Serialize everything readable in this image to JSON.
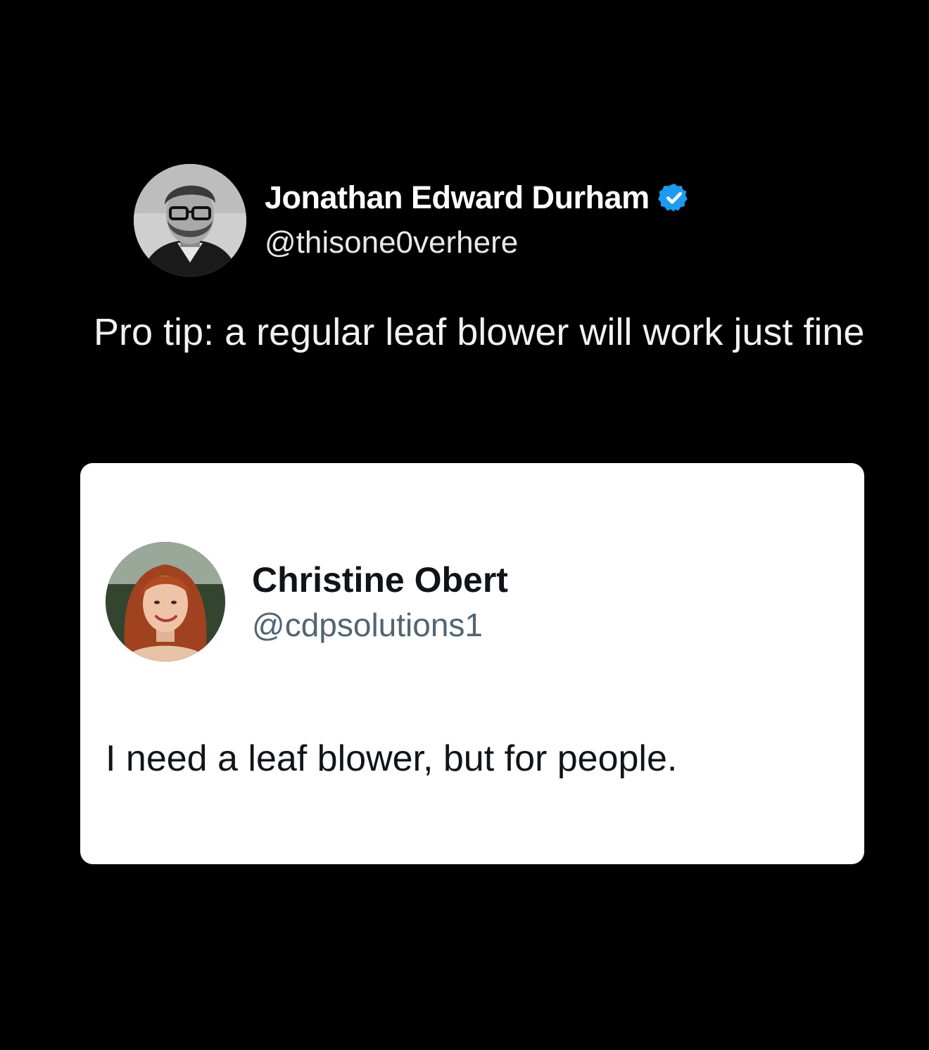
{
  "outer_tweet": {
    "display_name": "Jonathan Edward Durham",
    "handle": "@thisone0verhere",
    "verified": true,
    "avatar_icon": "man-with-glasses-avatar",
    "text": "Pro tip: a regular leaf blower will work just fine"
  },
  "quoted_tweet": {
    "display_name": "Christine Obert",
    "handle": "@cdpsolutions1",
    "avatar_icon": "woman-with-red-hair-avatar",
    "text": "I need a leaf blower, but for people."
  },
  "colors": {
    "background": "#000000",
    "verified_blue": "#1d9bf0",
    "card_background": "#ffffff",
    "handle_gray": "#536471"
  }
}
